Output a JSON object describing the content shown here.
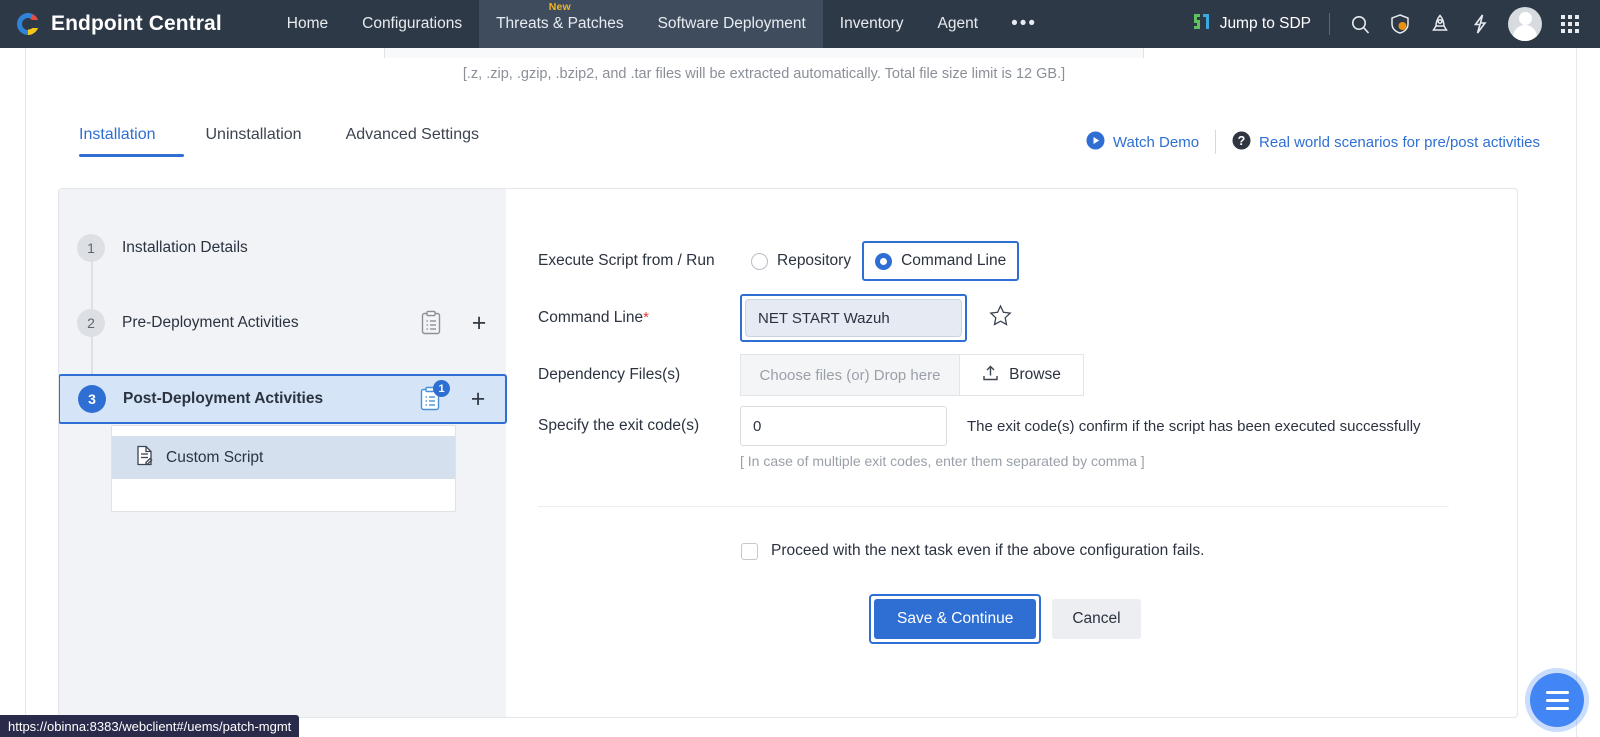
{
  "topnav": {
    "brand": "Endpoint Central",
    "items": [
      {
        "label": "Home",
        "active": false,
        "badge": ""
      },
      {
        "label": "Configurations",
        "active": false,
        "badge": ""
      },
      {
        "label": "Threats & Patches",
        "active": true,
        "badge": "New"
      },
      {
        "label": "Software Deployment",
        "active": true,
        "badge": ""
      },
      {
        "label": "Inventory",
        "active": false,
        "badge": ""
      },
      {
        "label": "Agent",
        "active": false,
        "badge": ""
      }
    ],
    "more_label": "•••",
    "jump_to_sdp": "Jump to SDP",
    "icons": [
      "search-icon",
      "shield-icon",
      "rocket-icon",
      "bolt-icon",
      "avatar",
      "app-grid-icon"
    ]
  },
  "upload_hint": "[.z, .zip, .gzip, .bzip2, and .tar files will be extracted automatically. Total file size limit is 12 GB.]",
  "tabs": [
    {
      "label": "Installation",
      "active": true
    },
    {
      "label": "Uninstallation",
      "active": false
    },
    {
      "label": "Advanced Settings",
      "active": false
    }
  ],
  "tab_links": {
    "watch_demo": "Watch Demo",
    "scenarios": "Real world scenarios for pre/post activities"
  },
  "steps": [
    {
      "num": "1",
      "label": "Installation Details",
      "active": false,
      "has_clip": false,
      "has_plus": false,
      "count": ""
    },
    {
      "num": "2",
      "label": "Pre-Deployment Activities",
      "active": false,
      "has_clip": true,
      "has_plus": true,
      "count": ""
    },
    {
      "num": "3",
      "label": "Post-Deployment Activities",
      "active": true,
      "has_clip": true,
      "has_plus": true,
      "count": "1"
    }
  ],
  "sublist": [
    {
      "label": "Custom Script",
      "selected": true
    }
  ],
  "form": {
    "execute_label": "Execute Script from / Run",
    "radio_options": [
      {
        "label": "Repository",
        "selected": false
      },
      {
        "label": "Command Line",
        "selected": true
      }
    ],
    "command_line_label": "Command Line",
    "command_line_required": "*",
    "command_line_value": "NET START Wazuh",
    "command_line_placeholder": "",
    "dependency_label": "Dependency Files(s)",
    "dependency_placeholder": "Choose files (or) Drop here",
    "browse_label": "Browse",
    "exit_label": "Specify the exit code(s)",
    "exit_value": "0",
    "exit_note": "The exit code(s) confirm if the script has been executed successfully",
    "exit_sub_note": "[ In case of multiple exit codes, enter them separated by comma ]",
    "proceed_label": "Proceed with the next task even if the above configuration fails.",
    "proceed_checked": false,
    "save_label": "Save & Continue",
    "cancel_label": "Cancel"
  },
  "statusbar": {
    "url": "https://obinna:8383/webclient#/uems/patch-mgmt"
  },
  "colors": {
    "header_bg": "#2e3947",
    "header_active": "#3e4c5e",
    "accent_blue": "#2f6fd4",
    "badge_gold": "#f0b429",
    "required_red": "#e4392f",
    "panel_gray": "#f1f3f7",
    "selected_row": "#d6e4f7",
    "fab_blue": "#4285f4",
    "statusbar_bg": "#2a2a4a"
  }
}
